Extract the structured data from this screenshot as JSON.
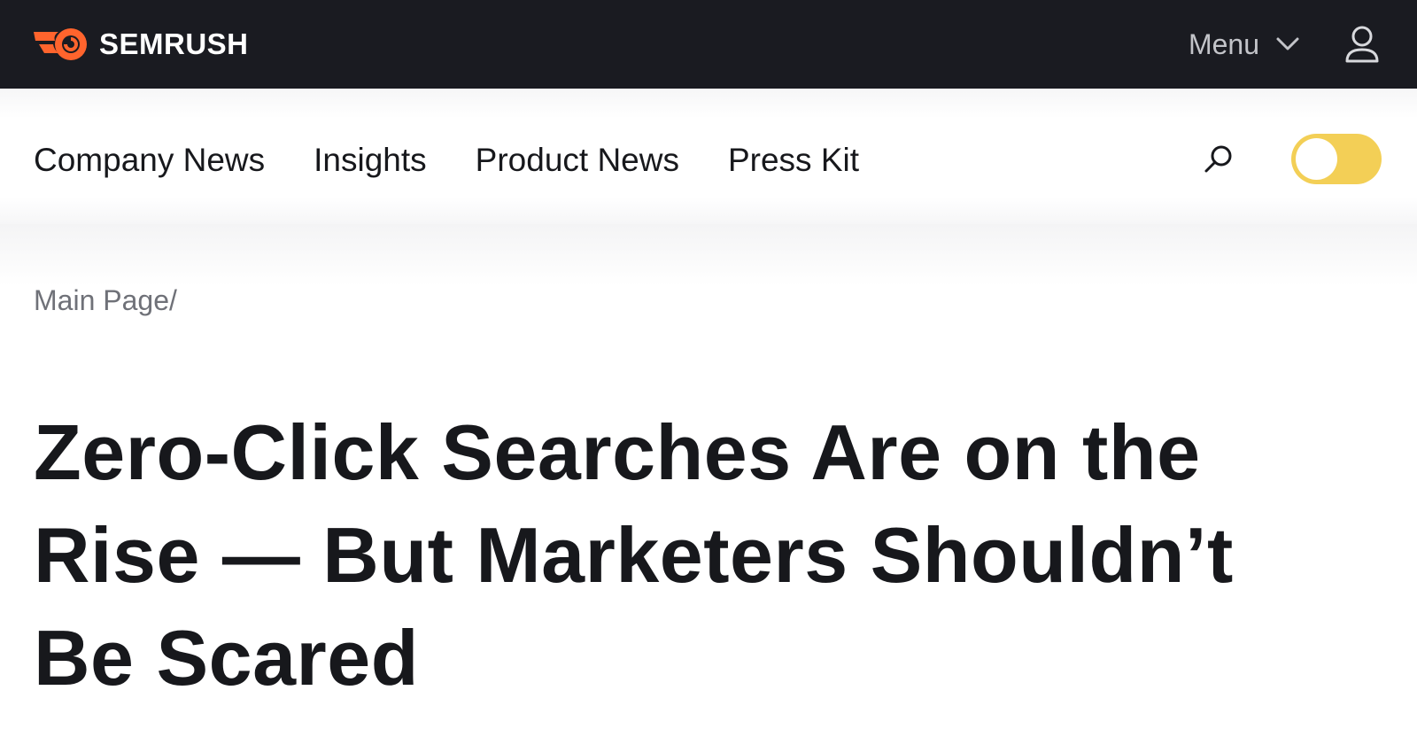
{
  "header": {
    "logo_text": "SEMRUSH",
    "menu_label": "Menu",
    "icons": [
      "semrush-flame-logo-icon",
      "chevron-down-icon",
      "user-icon"
    ]
  },
  "nav": {
    "links": [
      "Company News",
      "Insights",
      "Product News",
      "Press Kit"
    ],
    "search_icon": "search-icon",
    "toggle": {
      "state": "off",
      "color": "#F3CF56"
    }
  },
  "breadcrumb": {
    "main": "Main Page",
    "separator": "/"
  },
  "article": {
    "title": "Zero-Click Searches Are on the Rise — But Marketers Shouldn’t Be Scared"
  },
  "colors": {
    "topbar": "#1A1B21",
    "brand_orange": "#FF642D",
    "text": "#17181C",
    "muted": "#6F7178",
    "toggle": "#F3CF56"
  }
}
